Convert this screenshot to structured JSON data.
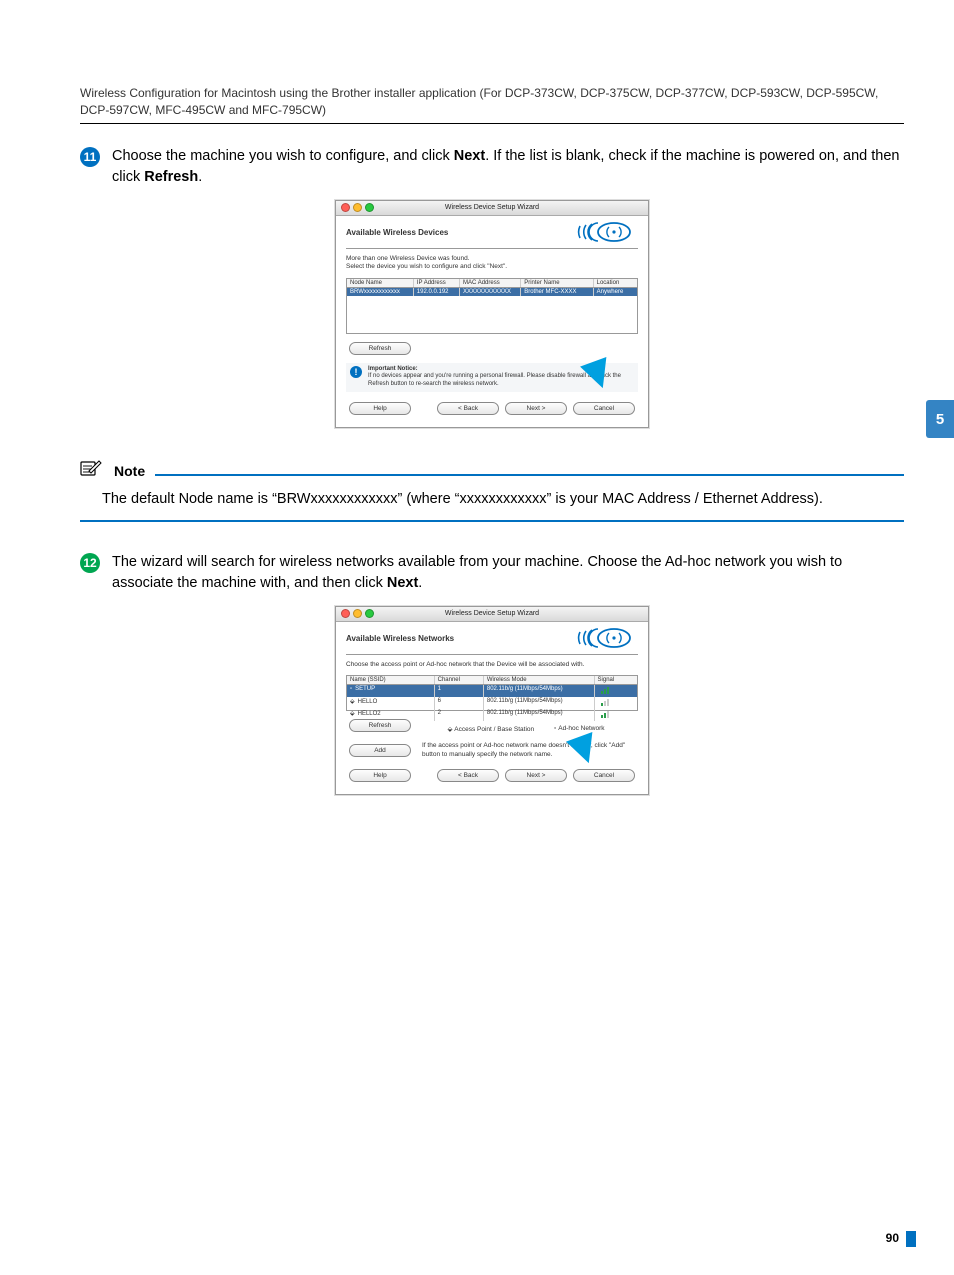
{
  "header": "Wireless Configuration for Macintosh using the Brother installer application (For DCP-373CW, DCP-375CW, DCP-377CW, DCP-593CW, DCP-595CW, DCP-597CW, MFC-495CW and MFC-795CW)",
  "tab_number": "5",
  "page_number": "90",
  "step11": {
    "num": "11",
    "text_a": "Choose the machine you wish to configure, and click ",
    "text_b": ". If the list is blank, check if the machine is powered on, and then click ",
    "bold1": "Next",
    "bold2": "Refresh",
    "text_c": "."
  },
  "shot1": {
    "titlebar": "Wireless Device Setup Wizard",
    "heading": "Available Wireless Devices",
    "desc": "More than one Wireless Device was found.\nSelect the device you wish to configure and click \"Next\".",
    "th": {
      "a": "Node Name",
      "b": "IP Address",
      "c": "MAC Address",
      "d": "Printer Name",
      "e": "Location"
    },
    "row": {
      "a": "BRWxxxxxxxxxxxx",
      "b": "192.0.0.192",
      "c": "XXXXXXXXXXXX",
      "d": "Brother MFC-XXXX",
      "e": "Anywhere"
    },
    "refresh": "Refresh",
    "notice_head": "Important Notice:",
    "notice_body": "If no devices appear and you're running a personal firewall. Please disable firewall and click the Refresh button to re-search the wireless network.",
    "help": "Help",
    "back": "< Back",
    "next": "Next >",
    "cancel": "Cancel"
  },
  "note": {
    "label": "Note",
    "body": "The default Node name is “BRWxxxxxxxxxxxx” (where “xxxxxxxxxxxx” is your MAC Address / Ethernet Address)."
  },
  "step12": {
    "num": "12",
    "text_a": "The wizard will search for wireless networks available from your machine. Choose the Ad-hoc network you wish to associate the machine with, and then click ",
    "bold1": "Next",
    "text_b": "."
  },
  "shot2": {
    "titlebar": "Wireless Device Setup Wizard",
    "heading": "Available Wireless Networks",
    "desc": "Choose the access point or Ad-hoc network that the Device will be associated with.",
    "th": {
      "a": "Name (SSID)",
      "b": "Channel",
      "c": "Wireless Mode",
      "d": "Signal"
    },
    "rows": [
      {
        "a": "SETUP",
        "b": "1",
        "c": "802.11b/g (11Mbps/54Mbps)",
        "sel": true
      },
      {
        "a": "HELLO",
        "b": "6",
        "c": "802.11b/g (11Mbps/54Mbps)",
        "sel": false
      },
      {
        "a": "HELLO2",
        "b": "2",
        "c": "802.11b/g (11Mbps/54Mbps)",
        "sel": false
      }
    ],
    "refresh": "Refresh",
    "legend_ap": "Access Point / Base Station",
    "legend_adhoc": "Ad-hoc Network",
    "add": "Add",
    "add_text": "If the access point or Ad-hoc network name doesn't appear, click \"Add\" button to manually specify the network name.",
    "help": "Help",
    "back": "< Back",
    "next": "Next >",
    "cancel": "Cancel"
  }
}
